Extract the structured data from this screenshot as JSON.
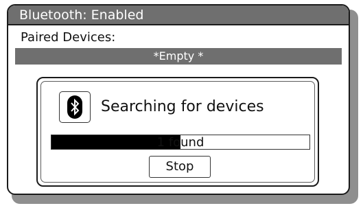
{
  "title_bar": {
    "text": "Bluetooth: Enabled"
  },
  "paired": {
    "label": "Paired Devices:",
    "devices": [
      "*Empty *"
    ]
  },
  "search_dialog": {
    "icon": "bluetooth-icon",
    "message": "Searching for devices",
    "progress": {
      "text": "1 found",
      "fraction": 0.5
    },
    "stop_label": "Stop"
  },
  "colors": {
    "bar": "#6f6f6f",
    "progress_fill": "#000000"
  }
}
